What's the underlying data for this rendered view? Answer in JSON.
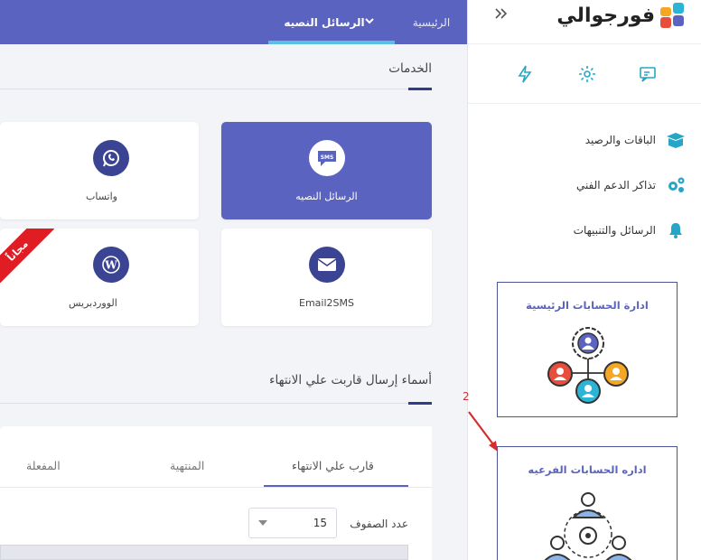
{
  "brand": {
    "name": "فورجوالي",
    "colors": [
      "#2cb4d6",
      "#f5a623",
      "#e94e3c",
      "#5b63c0"
    ]
  },
  "nav": {
    "home_label": "الرئيسية",
    "sms_label": "الرسائل النصيه",
    "chevron_icon": "chevron-down-icon"
  },
  "sidebar": {
    "collapse_icon": "double-chevron-right-icon",
    "quick_icons": [
      "chat-icon",
      "gear-icon",
      "bolt-icon"
    ],
    "menu": [
      {
        "label": "الباقات والرصيد",
        "icon": "box-icon"
      },
      {
        "label": "تذاكر الدعم الفني",
        "icon": "gears-icon"
      },
      {
        "label": "الرسائل والتنبيهات",
        "icon": "bell-icon"
      }
    ],
    "cards": [
      {
        "title": "ادارة الحسابات الرئيسية",
        "icon": "network-users-icon"
      },
      {
        "title": "اداره الحسابات الفرعيه",
        "icon": "team-cycle-icon"
      }
    ]
  },
  "annotation": {
    "number": "2",
    "color": "#d32f2f"
  },
  "services": {
    "title": "الخدمات",
    "items": [
      {
        "label": "الرسائل النصيه",
        "icon": "sms-icon",
        "active": true
      },
      {
        "label": "واتساب",
        "icon": "whatsapp-icon",
        "active": false
      },
      {
        "label": "Email2SMS",
        "icon": "envelope-icon",
        "active": false
      },
      {
        "label": "الووردبريس",
        "icon": "wordpress-icon",
        "active": false,
        "ribbon": "مجاناً"
      }
    ]
  },
  "expiring": {
    "title": "أسماء إرسال قاربت علي الانتهاء",
    "tabs": [
      {
        "label": "قارب علي الانتهاء",
        "active": true
      },
      {
        "label": "المنتهية",
        "active": false
      },
      {
        "label": "المفعلة",
        "active": false
      }
    ],
    "rows_label": "عدد الصفوف",
    "rows_value": "15"
  }
}
